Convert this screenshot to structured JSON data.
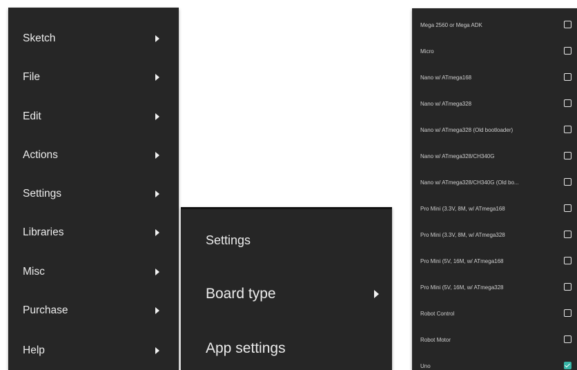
{
  "main_menu": {
    "items": [
      {
        "label": "Sketch"
      },
      {
        "label": "File"
      },
      {
        "label": "Edit"
      },
      {
        "label": "Actions"
      },
      {
        "label": "Settings"
      },
      {
        "label": "Libraries"
      },
      {
        "label": "Misc"
      },
      {
        "label": "Purchase"
      },
      {
        "label": "Help"
      }
    ]
  },
  "settings_menu": {
    "header": "Settings",
    "items": [
      {
        "label": "Board type"
      },
      {
        "label": "App settings"
      }
    ]
  },
  "board_list": {
    "items": [
      {
        "label": "Mega 2560 or Mega ADK",
        "checked": false
      },
      {
        "label": "Micro",
        "checked": false
      },
      {
        "label": "Nano w/ ATmega168",
        "checked": false
      },
      {
        "label": "Nano w/ ATmega328",
        "checked": false
      },
      {
        "label": "Nano w/ ATmega328 (Old bootloader)",
        "checked": false
      },
      {
        "label": "Nano w/ ATmega328/CH340G",
        "checked": false
      },
      {
        "label": "Nano w/ ATmega328/CH340G (Old bo...",
        "checked": false
      },
      {
        "label": "Pro Mini (3.3V, 8M, w/ ATmega168",
        "checked": false
      },
      {
        "label": "Pro Mini (3.3V, 8M, w/ ATmega328",
        "checked": false
      },
      {
        "label": "Pro Mini (5V, 16M, w/ ATmega168",
        "checked": false
      },
      {
        "label": "Pro Mini (5V, 16M, w/ ATmega328",
        "checked": false
      },
      {
        "label": "Robot Control",
        "checked": false
      },
      {
        "label": "Robot Motor",
        "checked": false
      },
      {
        "label": "Uno",
        "checked": true
      }
    ]
  },
  "colors": {
    "menu_background": "#262626",
    "text": "#ececec",
    "checkbox_checked": "#36b4a6"
  }
}
